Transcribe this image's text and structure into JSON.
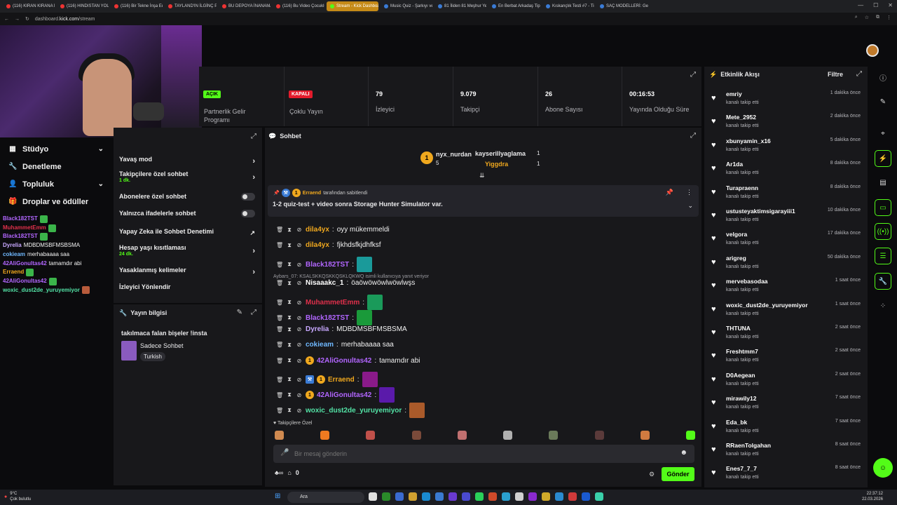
{
  "browser": {
    "tabs": [
      "(116) KIRAN KIRANA MÜC",
      "(116) HINDISTAN YOLCU",
      "(116) Bir Tekne İnşa Eden",
      "TAYLAND'IN İLGİNÇ PAZ",
      "BU DEPOYA İNANAMAYA",
      "(116) Bu Video Çocukluk T",
      "Stream - Kick Dashboard",
      "Music Quiz - Şarkıyı veya",
      "81 İliden 81 Meşhur Yemek",
      "En Berbat Arkadaş Tipi?",
      "Kıskançlık Testi #7 - Tier L",
      "SAÇ MODELLERİ: Geçmiş"
    ],
    "url_prefix": "dashboard.",
    "url_domain": "kick.com",
    "url_path": "/stream"
  },
  "left_menu": {
    "items": [
      {
        "label": "Stüdyo",
        "icon": "grid-icon"
      },
      {
        "label": "Denetleme",
        "icon": "wrench-icon"
      },
      {
        "label": "Topluluk",
        "icon": "users-icon"
      },
      {
        "label": "Droplar ve ödüller",
        "icon": "gift-icon"
      }
    ]
  },
  "overlay_chat": [
    {
      "user": "Black182TST",
      "color": "#b266ff",
      "msg": ""
    },
    {
      "user": "MuhammetEmm",
      "color": "#e0304b",
      "msg": ""
    },
    {
      "user": "Black182TST",
      "color": "#b266ff",
      "msg": ""
    },
    {
      "user": "Dyrelia",
      "color": "#c8a8ff",
      "msg": "MDBDMSBFMSBSMA"
    },
    {
      "user": "cokieam",
      "color": "#6fb8ff",
      "msg": "merhabaaaa saa"
    },
    {
      "user": "42AliGonultas42",
      "color": "#b266ff",
      "msg": "tamamdır abi"
    },
    {
      "user": "Erraend",
      "color": "#f0a81e",
      "msg": ""
    },
    {
      "user": "42AliGonultas42",
      "color": "#b266ff",
      "msg": ""
    },
    {
      "user": "woxic_dust2de_yuruyemiyor",
      "color": "#53e3a6",
      "msg": ""
    }
  ],
  "stats": [
    {
      "badge": "AÇIK",
      "label1": "Partnerlik Gelir",
      "label2": "Programı"
    },
    {
      "badge": "KAPALI",
      "label1": "Çoklu Yayın"
    },
    {
      "value": "79",
      "label1": "İzleyici"
    },
    {
      "value": "9.079",
      "label1": "Takipçi"
    },
    {
      "value": "26",
      "label1": "Abone Sayısı"
    },
    {
      "value": "00:16:53",
      "label1": "Yayında Olduğu Süre"
    }
  ],
  "settings": {
    "rows": [
      {
        "label": "Yavaş mod",
        "type": "arrow"
      },
      {
        "label": "Takipçilere özel sohbet",
        "sub": "1 dk.",
        "type": "arrow"
      },
      {
        "label": "Abonelere özel sohbet",
        "type": "toggle"
      },
      {
        "label": "Yalnızca ifadelerle sohbet",
        "type": "toggle"
      },
      {
        "label": "Yapay Zeka ile Sohbet Denetimi",
        "type": "link"
      },
      {
        "label": "Hesap yaşı kısıtlaması",
        "sub": "24 dk.",
        "type": "arrow"
      },
      {
        "label": "Yasaklanmış kelimeler",
        "type": "arrow"
      },
      {
        "label": "İzleyici Yönlendir",
        "type": "none"
      }
    ]
  },
  "stream_info": {
    "title": "Yayın bilgisi",
    "stream_title": "takılmaca falan bişeler !insta",
    "category": "Sadece Sohbet",
    "language": "Turkish"
  },
  "chat": {
    "title": "Sohbet",
    "top_gifters": [
      {
        "name": "nyx_nurdan",
        "count": "5",
        "rank": "1"
      },
      {
        "name": "kayserillyaglama",
        "count": "1"
      },
      {
        "name": "Yiggdra",
        "count": "1"
      }
    ],
    "pinned": {
      "by_user": "Erraend",
      "by_text": "tarafından sabitlendi",
      "message": "1-2 quiz-test + video sonra Storage Hunter Simulator var."
    },
    "reply_note": "Aybars_07: KSALSKKQSKKQSKLQKWQ isimli kullanıcıya yanıt veriyor",
    "messages": [
      {
        "user": "dila4yx",
        "color": "#f0a81e",
        "msg": "oyy mükemmeldi"
      },
      {
        "user": "dila4yx",
        "color": "#f0a81e",
        "msg": "fjkhdsfkjdhfksf"
      },
      {
        "user": "Black182TST",
        "color": "#b266ff",
        "msg": ""
      },
      {
        "user": "Nisaaakc_1",
        "color": "#ffffff",
        "msg": "öaöwöwöwlwöwlwşs"
      },
      {
        "user": "MuhammetEmm",
        "color": "#e0304b",
        "msg": ""
      },
      {
        "user": "Black182TST",
        "color": "#b266ff",
        "msg": ""
      },
      {
        "user": "Dyrelia",
        "color": "#c8a8ff",
        "msg": "MDBDMSBFMSBSMA"
      },
      {
        "user": "cokieam",
        "color": "#6fb8ff",
        "msg": "merhabaaaa saa"
      },
      {
        "user": "42AliGonultas42",
        "color": "#b266ff",
        "msg": "tamamdır abi"
      },
      {
        "user": "Erraend",
        "color": "#f0a81e",
        "msg": ""
      },
      {
        "user": "42AliGonultas42",
        "color": "#b266ff",
        "msg": ""
      },
      {
        "user": "woxic_dust2de_yuruyemiyor",
        "color": "#53e3a6",
        "msg": ""
      }
    ],
    "followers_only_label": "Takipçilere Özel",
    "input_placeholder": "Bir mesaj gönderin",
    "send_label": "Gönder",
    "points_count": "0"
  },
  "activity": {
    "title": "Etkinlik Akışı",
    "filter_label": "Filtre",
    "items": [
      {
        "name": "emriy",
        "what": "kanalı takip etti",
        "time": "1 dakika önce"
      },
      {
        "name": "Mete_2952",
        "what": "kanalı takip etti",
        "time": "2 dakika önce"
      },
      {
        "name": "xbunyamin_x16",
        "what": "kanalı takip etti",
        "time": "5 dakika önce"
      },
      {
        "name": "Ar1da",
        "what": "kanalı takip etti",
        "time": "8 dakika önce"
      },
      {
        "name": "Turapraenn",
        "what": "kanalı takip etti",
        "time": "8 dakika önce"
      },
      {
        "name": "ustusteyaktimsigarayiii1",
        "what": "kanalı takip etti",
        "time": "10 dakika önce"
      },
      {
        "name": "velgora",
        "what": "kanalı takip etti",
        "time": "17 dakika önce"
      },
      {
        "name": "arigreg",
        "what": "kanalı takip etti",
        "time": "50 dakika önce"
      },
      {
        "name": "mervebasodaa",
        "what": "kanalı takip etti",
        "time": "1 saat önce"
      },
      {
        "name": "woxic_dust2de_yuruyemiyor",
        "what": "kanalı takip etti",
        "time": "1 saat önce"
      },
      {
        "name": "THTUNA",
        "what": "kanalı takip etti",
        "time": "2 saat önce"
      },
      {
        "name": "Freshtmm7",
        "what": "kanalı takip etti",
        "time": "2 saat önce"
      },
      {
        "name": "D0Aegean",
        "what": "kanalı takip etti",
        "time": "2 saat önce"
      },
      {
        "name": "mirawily12",
        "what": "kanalı takip etti",
        "time": "7 saat önce"
      },
      {
        "name": "Eda_bk",
        "what": "kanalı takip etti",
        "time": "7 saat önce"
      },
      {
        "name": "RRaenTolgahan",
        "what": "kanalı takip etti",
        "time": "8 saat önce"
      },
      {
        "name": "Enes7_7_7",
        "what": "kanalı takip etti",
        "time": "8 saat önce"
      }
    ]
  },
  "taskbar": {
    "weather_temp": "9°C",
    "weather_text": "Çok bulutlu",
    "search_label": "Ara",
    "time": "22:37:12",
    "date": "22.03.2026"
  },
  "colors": {
    "accent": "#53fc18",
    "panel": "#18181b",
    "bg": "#0b0b0d"
  }
}
